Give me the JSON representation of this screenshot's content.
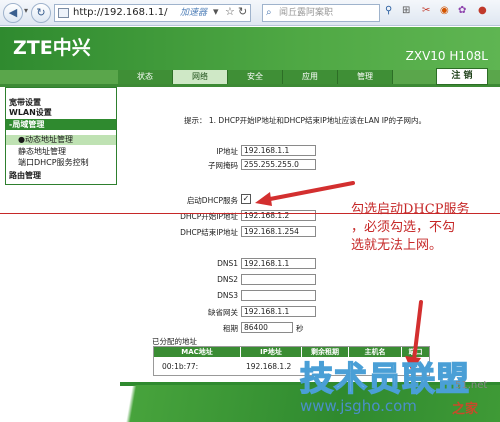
{
  "browser": {
    "back_icon": "back-arrow-icon",
    "refresh_icon": "refresh-icon",
    "url": "http://192.168.1.1/",
    "accelerator_label": "加速器",
    "search_placeholder": "闻丘露阿案职",
    "icons": [
      "down-arrow",
      "star",
      "refresh",
      "tools",
      "scissors",
      "shop",
      "palette"
    ]
  },
  "router": {
    "brand": "ZTE中兴",
    "model": "ZXV10 H108L",
    "tabs": [
      {
        "label": "状态",
        "active": false
      },
      {
        "label": "网络",
        "active": true
      },
      {
        "label": "安全",
        "active": false
      },
      {
        "label": "应用",
        "active": false
      },
      {
        "label": "管理",
        "active": false
      }
    ],
    "logout_label": "注 销"
  },
  "sidebar": {
    "items": [
      {
        "label": "宽带设置"
      },
      {
        "label": "WLAN设置"
      },
      {
        "label": "-局域管理"
      },
      {
        "label": "●动态地址管理"
      },
      {
        "label": "静态地址管理"
      },
      {
        "label": "端口DHCP服务控制"
      },
      {
        "label": "路由管理"
      }
    ]
  },
  "form": {
    "hint": "提示： 1. DHCP开始IP地址和DHCP结束IP地址应该在LAN IP的子网内。",
    "ip_label": "IP地址",
    "ip_value": "192.168.1.1",
    "mask_label": "子网掩码",
    "mask_value": "255.255.255.0",
    "dhcp_label": "启动DHCP服务",
    "dhcp_checked": "✓",
    "start_label": "DHCP开始IP地址",
    "start_value": "192.168.1.2",
    "end_label": "DHCP结束IP地址",
    "end_value": "192.168.1.254",
    "dns1_label": "DNS1",
    "dns1_value": "192.168.1.1",
    "dns2_label": "DNS2",
    "dns2_value": "",
    "dns3_label": "DNS3",
    "dns3_value": "",
    "gateway_label": "缺省网关",
    "gateway_value": "192.168.1.1",
    "lease_label": "租期",
    "lease_value": "86400",
    "lease_unit": "秒"
  },
  "annotation": {
    "lines": [
      "勾选启动DHCP服务",
      "，必须勾选，不勾",
      "选就无法上网。"
    ],
    "color": "#c62828"
  },
  "allocated": {
    "title": "已分配的地址",
    "headers": [
      "MAC地址",
      "IP地址",
      "剩余租期",
      "主机名",
      "端口"
    ],
    "rows": [
      {
        "mac": "00:1b:77:",
        "ip": "192.168.1.2"
      }
    ]
  },
  "watermark": {
    "big": "技术员联盟",
    "url": "www.jsgho.com",
    "side": "51.net",
    "side2": "之家"
  },
  "colors": {
    "brand_green": "#2f8a2f",
    "tab_active": "#cfe8c6",
    "annotation_red": "#c62828"
  }
}
